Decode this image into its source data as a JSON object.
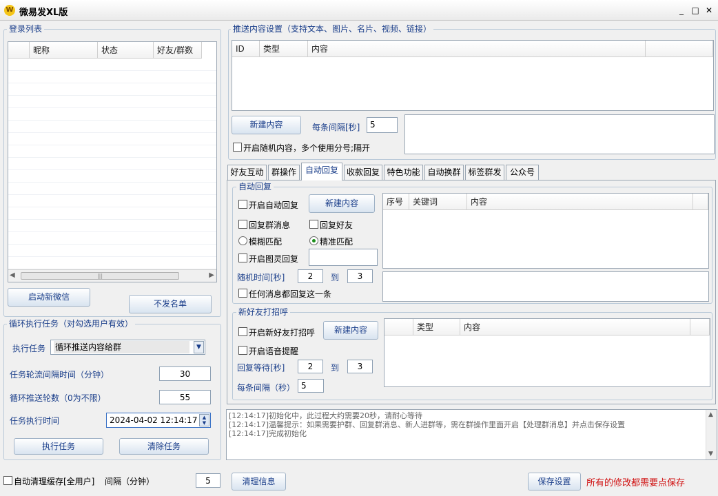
{
  "app": {
    "title": "微易发XL版",
    "icon_glyph": "W"
  },
  "window": {
    "minimize": "_",
    "maximize": "□",
    "close": "✕"
  },
  "login_list": {
    "title": "登录列表",
    "columns": [
      "",
      "昵称",
      "状态",
      "好友/群数"
    ],
    "hscroll_grip": "|||"
  },
  "buttons": {
    "start_wechat": "启动新微信",
    "blacklist": "不发名单",
    "execute_task": "执行任务",
    "clear_task": "清除任务",
    "clear_info": "清理信息",
    "save_settings": "保存设置",
    "new_content": "新建内容",
    "auto_reply_new": "新建内容",
    "greet_new": "新建内容"
  },
  "loop_task": {
    "title": "循环执行任务（对勾选用户有效）",
    "exec_label": "执行任务",
    "exec_value": "循环推送内容给群",
    "interval_label": "任务轮流间隔时间（分钟）",
    "interval_value": "30",
    "rounds_label": "循环推送轮数（0为不限）",
    "rounds_value": "55",
    "time_label": "任务执行时间",
    "time_value": "2024-04-02 12:14:17"
  },
  "auto_clean": {
    "label": "自动清理缓存[全用户]",
    "interval_label": "间隔（分钟）",
    "interval_value": "5"
  },
  "push": {
    "title": "推送内容设置（支持文本、图片、名片、视频、链接）",
    "columns": [
      "ID",
      "类型",
      "内容",
      ""
    ],
    "each_interval_label": "每条间隔[秒]",
    "each_interval_value": "5",
    "random_label": "开启随机内容，多个使用分号;隔开"
  },
  "tabs": [
    "好友互动",
    "群操作",
    "自动回复",
    "收款回复",
    "特色功能",
    "自动换群",
    "标签群发",
    "公众号"
  ],
  "auto_reply": {
    "title": "自动回复",
    "enable_label": "开启自动回复",
    "group_label": "回复群消息",
    "friend_label": "回复好友",
    "fuzzy_label": "模糊匹配",
    "exact_label": "精准匹配",
    "tuling_label": "开启图灵回复",
    "random_time_label": "随机时间[秒]",
    "from_value": "2",
    "to_label": "到",
    "to_value": "3",
    "any_label": "任何消息都回复这一条",
    "columns": [
      "序号",
      "关键词",
      "内容",
      ""
    ]
  },
  "greet": {
    "title": "新好友打招呼",
    "enable_label": "开启新好友打招呼",
    "voice_label": "开启语音提醒",
    "wait_label": "回复等待[秒]",
    "from_value": "2",
    "to_label": "到",
    "to_value": "3",
    "each_label": "每条间隔（秒）",
    "each_value": "5",
    "columns": [
      "",
      "类型",
      "内容",
      ""
    ]
  },
  "log": [
    "[12:14:17]初始化中，此过程大约需要20秒，请耐心等待",
    "[12:14:17]温馨提示：如果需要护群、回复群消息、新人进群等，需在群操作里面开启【处理群消息】并点击保存设置",
    "[12:14:17]完成初始化"
  ],
  "footer": {
    "notice": "所有的修改都需要点保存"
  },
  "colors": {
    "accent": "#1a3e8a",
    "notice": "#d01010"
  }
}
